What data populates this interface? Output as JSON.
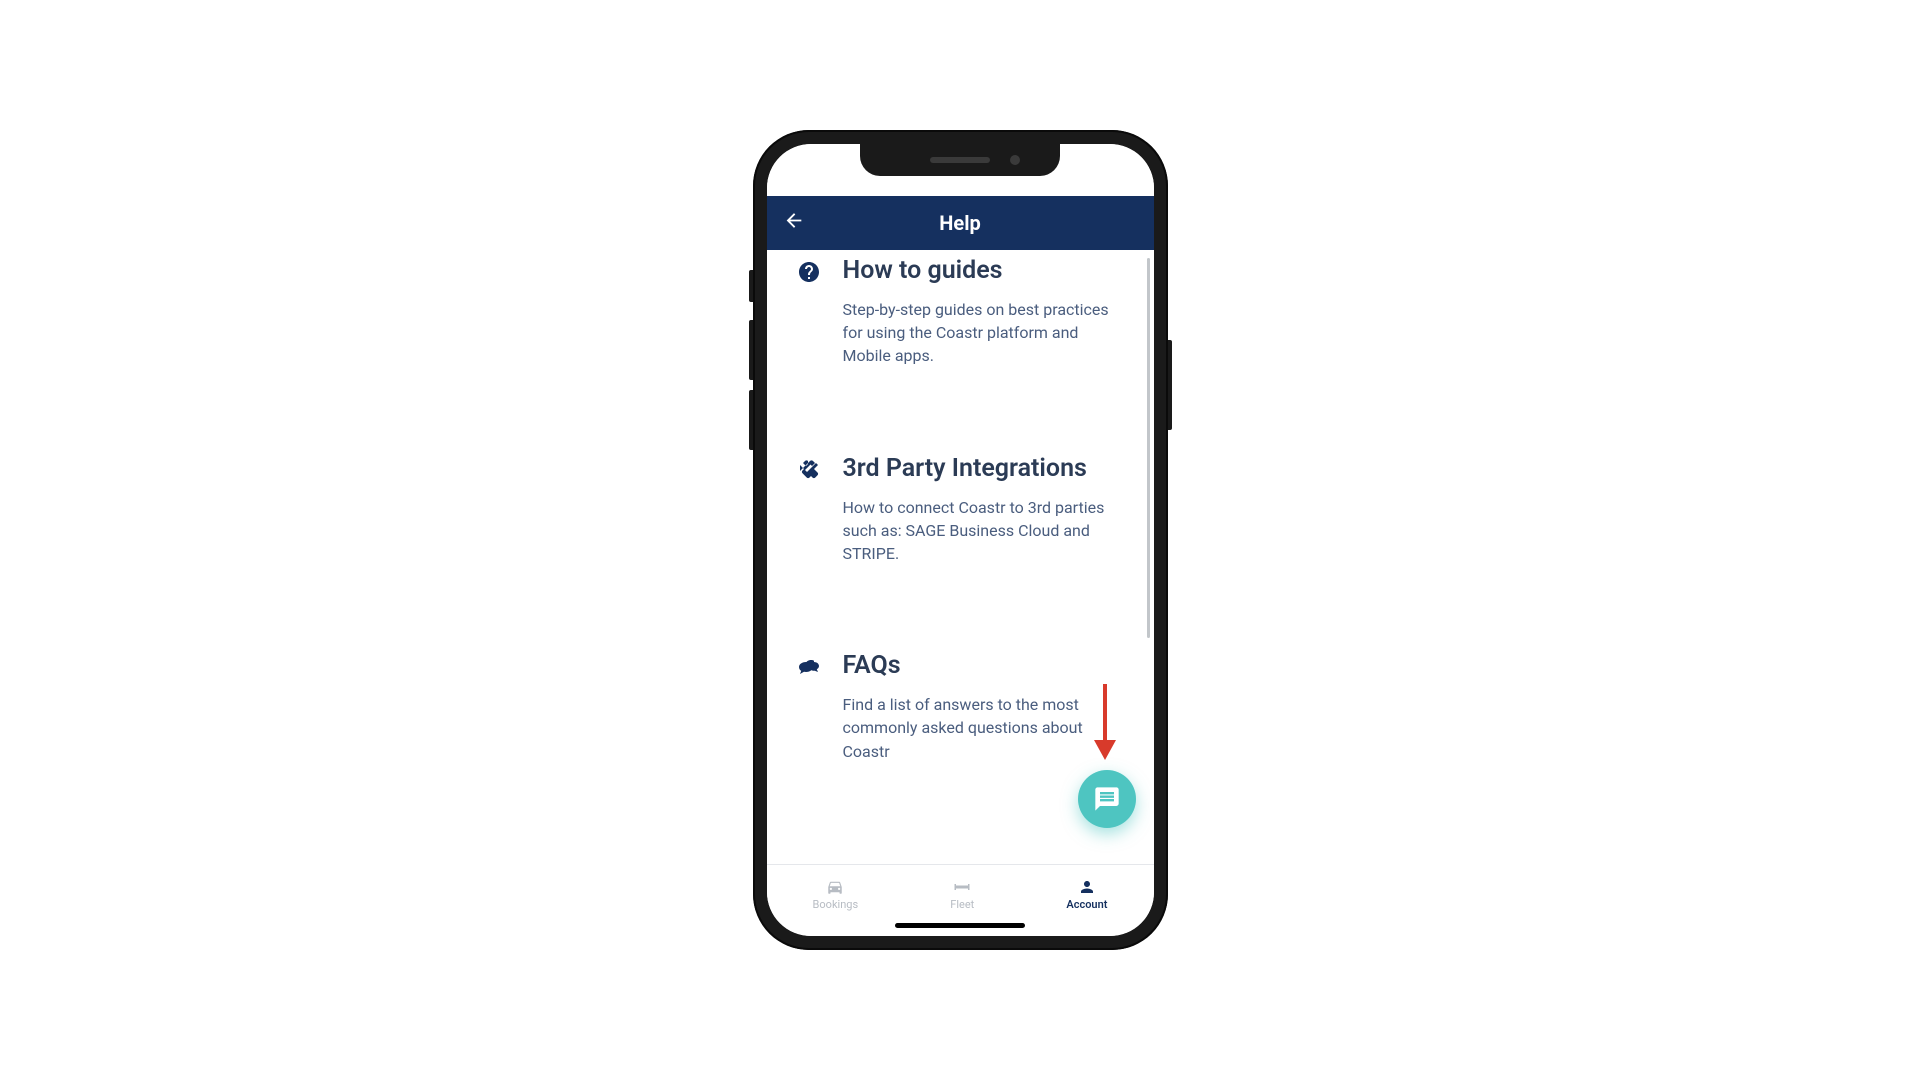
{
  "header": {
    "title": "Help"
  },
  "sections": [
    {
      "title": "How to guides",
      "desc": "Step-by-step guides on best practices for using the Coastr platform and Mobile apps."
    },
    {
      "title": "3rd Party Integrations",
      "desc": "How to connect Coastr to 3rd parties such as: SAGE Business Cloud and STRIPE."
    },
    {
      "title": "FAQs",
      "desc": "Find a list of answers to the most commonly asked questions about Coastr"
    }
  ],
  "nav": {
    "bookings": "Bookings",
    "fleet": "Fleet",
    "account": "Account"
  }
}
